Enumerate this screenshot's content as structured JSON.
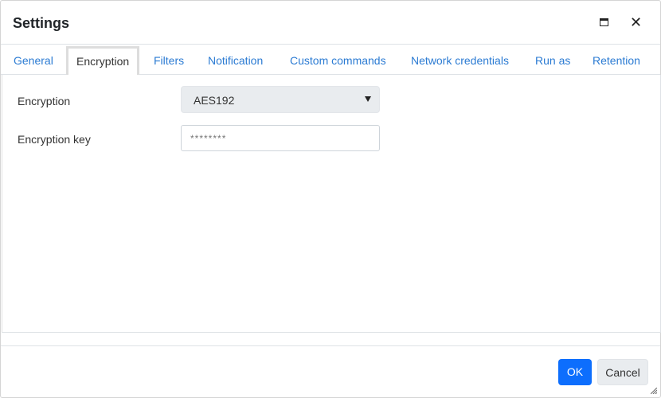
{
  "dialog": {
    "title": "Settings",
    "maximize_icon": "maximize-icon",
    "close_icon": "close-icon",
    "close_glyph": "✕"
  },
  "tabs": [
    {
      "label": "General",
      "active": false
    },
    {
      "label": "Encryption",
      "active": true
    },
    {
      "label": "Filters",
      "active": false
    },
    {
      "label": "Notification",
      "active": false
    },
    {
      "label": "Custom commands",
      "active": false
    },
    {
      "label": "Network credentials",
      "active": false
    },
    {
      "label": "Run as",
      "active": false
    },
    {
      "label": "Retention",
      "active": false
    }
  ],
  "form": {
    "encryption_label": "Encryption",
    "encryption_value": "AES192",
    "key_label": "Encryption key",
    "key_value": "********"
  },
  "footer": {
    "ok_label": "OK",
    "cancel_label": "Cancel"
  },
  "colors": {
    "link": "#2b7bd3",
    "primary": "#0d6efd",
    "secondary": "#e9ecef"
  }
}
